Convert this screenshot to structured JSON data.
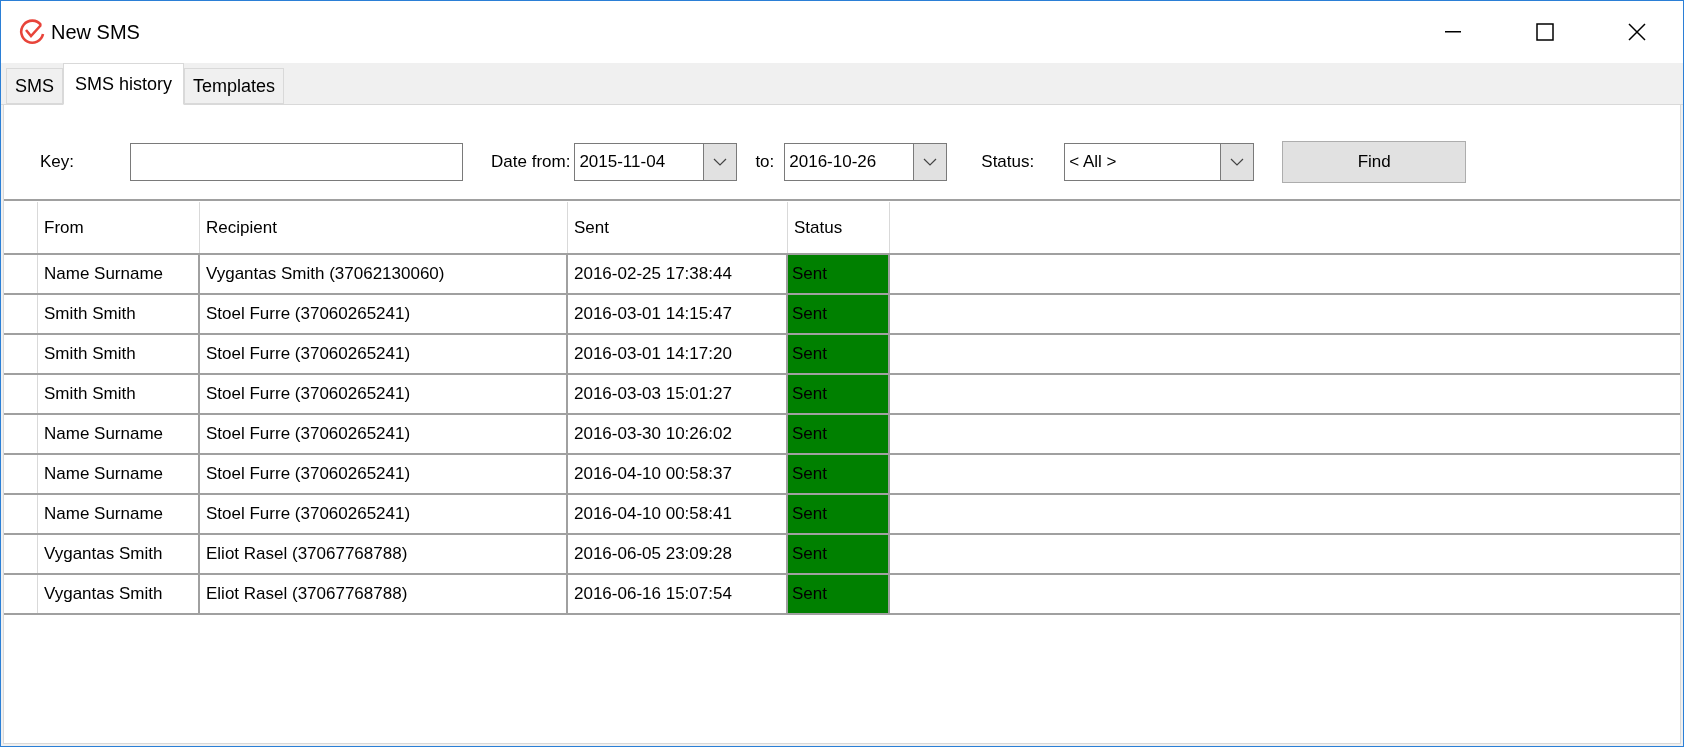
{
  "window": {
    "title": "New SMS"
  },
  "tabs": [
    {
      "label": "SMS",
      "selected": false
    },
    {
      "label": "SMS history",
      "selected": true
    },
    {
      "label": "Templates",
      "selected": false
    }
  ],
  "filters": {
    "key_label": "Key:",
    "date_from_label": "Date from:",
    "date_from": "2015-11-04",
    "date_to_label": "to:",
    "date_to": "2016-10-26",
    "status_label": "Status:",
    "status": "< All >",
    "find_button": "Find"
  },
  "table": {
    "columns": [
      "From",
      "Recipient",
      "Sent",
      "Status"
    ],
    "rows": [
      {
        "from": "Name Surname",
        "recipient": "Vygantas Smith (37062130060)",
        "sent": "2016-02-25 17:38:44",
        "status": "Sent",
        "color": "#008000"
      },
      {
        "from": "Smith Smith",
        "recipient": "Stoel Furre (37060265241)",
        "sent": "2016-03-01 14:15:47",
        "status": "Sent",
        "color": "#008000"
      },
      {
        "from": "Smith Smith",
        "recipient": "Stoel Furre (37060265241)",
        "sent": "2016-03-01 14:17:20",
        "status": "Sent",
        "color": "#008000"
      },
      {
        "from": "Smith Smith",
        "recipient": "Stoel Furre (37060265241)",
        "sent": "2016-03-03 15:01:27",
        "status": "Sent",
        "color": "#008000"
      },
      {
        "from": "Name Surname",
        "recipient": "Stoel Furre (37060265241)",
        "sent": "2016-03-30 10:26:02",
        "status": "Sent",
        "color": "#008000"
      },
      {
        "from": "Name Surname",
        "recipient": "Stoel Furre (37060265241)",
        "sent": "2016-04-10 00:58:37",
        "status": "Sent",
        "color": "#008000"
      },
      {
        "from": "Name Surname",
        "recipient": "Stoel Furre (37060265241)",
        "sent": "2016-04-10 00:58:41",
        "status": "Sent",
        "color": "#008000"
      },
      {
        "from": "Vygantas Smith",
        "recipient": "Eliot Rasel (37067768788)",
        "sent": "2016-06-05 23:09:28",
        "status": "Sent",
        "color": "#008000"
      },
      {
        "from": "Vygantas Smith",
        "recipient": "Eliot Rasel (37067768788)",
        "sent": "2016-06-16 15:07:54",
        "status": "Sent",
        "color": "#008000"
      }
    ]
  }
}
